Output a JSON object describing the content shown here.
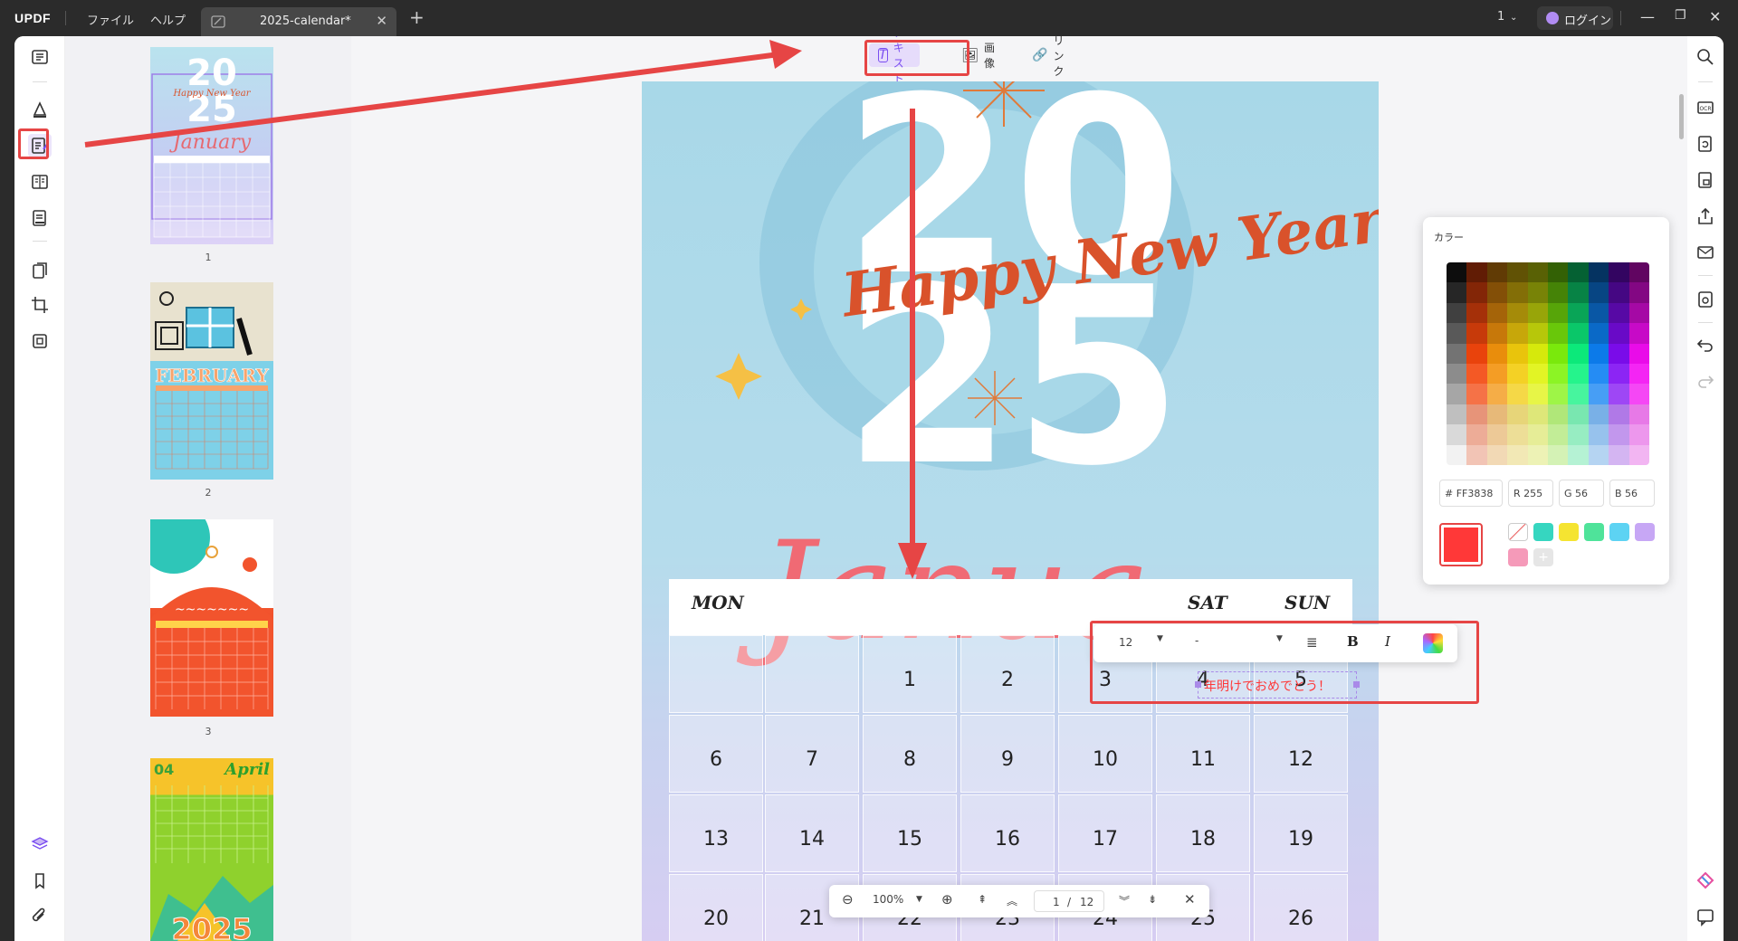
{
  "app": {
    "logo": "UPDF",
    "menu_file": "ファイル",
    "menu_help": "ヘルプ",
    "tab_title": "2025-calendar*",
    "page_selector": "1",
    "login": "ログイン"
  },
  "toolbar": {
    "text": "テキスト",
    "image": "画像",
    "link": "リンク"
  },
  "thumbnails": {
    "labels": [
      "1",
      "2",
      "3"
    ],
    "page1_title": "January",
    "page2_title": "FEBRUARY",
    "page4_month": "April",
    "page4_num": "04",
    "page4_year": "2025"
  },
  "page": {
    "happy": "Happy New Year",
    "month": "Janua",
    "big_year_top": "20",
    "big_year_bottom": "25",
    "days": [
      "MON",
      "SAT",
      "SUN"
    ],
    "row1": [
      "",
      "",
      "1",
      "2",
      "3",
      "4",
      "5"
    ],
    "row2": [
      "6",
      "7",
      "8",
      "9",
      "10",
      "11",
      "12"
    ],
    "row3": [
      "13",
      "14",
      "15",
      "16",
      "17",
      "18",
      "19"
    ],
    "row4": [
      "20",
      "21",
      "22",
      "23",
      "24",
      "25",
      "26"
    ]
  },
  "text_box": {
    "value": "年明けでおめでとう！",
    "color": "#FF3838"
  },
  "format_toolbar": {
    "font_size": "12",
    "font_name": "-",
    "bold": "B",
    "italic": "I"
  },
  "color_panel": {
    "title": "カラー",
    "hex": "# FF3838",
    "r": "R 255",
    "g": "G 56",
    "b": "B 56",
    "current": "#FF3838",
    "recent": [
      "#36d6c0",
      "#f5e431",
      "#4fe39a",
      "#5dd3f3",
      "#c7a7f5",
      "#f59ab9"
    ]
  },
  "zoom": {
    "level": "100%",
    "current_page": "1",
    "total_pages": "12",
    "sep": "/"
  },
  "colors": {
    "accent": "#e64545",
    "purple": "#7a4ef0"
  }
}
